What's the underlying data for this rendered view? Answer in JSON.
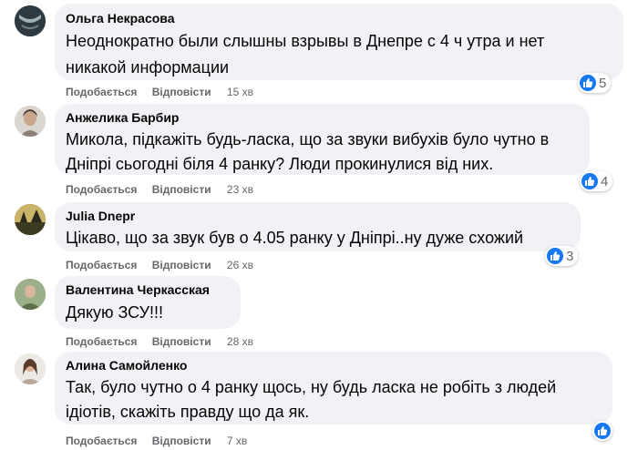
{
  "comments": [
    {
      "author": "Ольга Некрасова",
      "text_lines": [
        "Неоднократно были слышны взрывы в Днепре с 4 ч утра и нет",
        "никакой информации"
      ],
      "like_label": "Подобається",
      "reply_label": "Відповісти",
      "time": "15 хв",
      "reaction_count": "5"
    },
    {
      "author": "Анжелика Барбир",
      "text_lines": [
        "Микола, підкажіть будь-ласка, що за звуки вибухів було чутно в",
        "Дніпрі сьогодні біля 4 ранку? Люди прокинулися від них."
      ],
      "like_label": "Подобається",
      "reply_label": "Відповісти",
      "time": "23 хв",
      "reaction_count": "4"
    },
    {
      "author": "Julia Dnepr",
      "text_lines": [
        "Цікаво, що за звук був о 4.05 ранку у Дніпрі..ну дуже схожий"
      ],
      "like_label": "Подобається",
      "reply_label": "Відповісти",
      "time": "26 хв",
      "reaction_count": "3"
    },
    {
      "author": "Валентина Черкасская",
      "text_lines": [
        "Дякую ЗСУ!!!"
      ],
      "like_label": "Подобається",
      "reply_label": "Відповісти",
      "time": "28 хв",
      "reaction_count": ""
    },
    {
      "author": "Алина Самойленко",
      "text_lines": [
        "Так, було чутно о 4 ранку щось, ну будь ласка не робіть з людей",
        "ідіотів, скажіть правду що да як."
      ],
      "like_label": "Подобається",
      "reply_label": "Відповісти",
      "time": "7 хв",
      "reaction_count": ""
    }
  ],
  "colors": {
    "bubble": "#f0f2f5",
    "like_blue": "#1877f2",
    "meta_gray": "#65676b"
  }
}
